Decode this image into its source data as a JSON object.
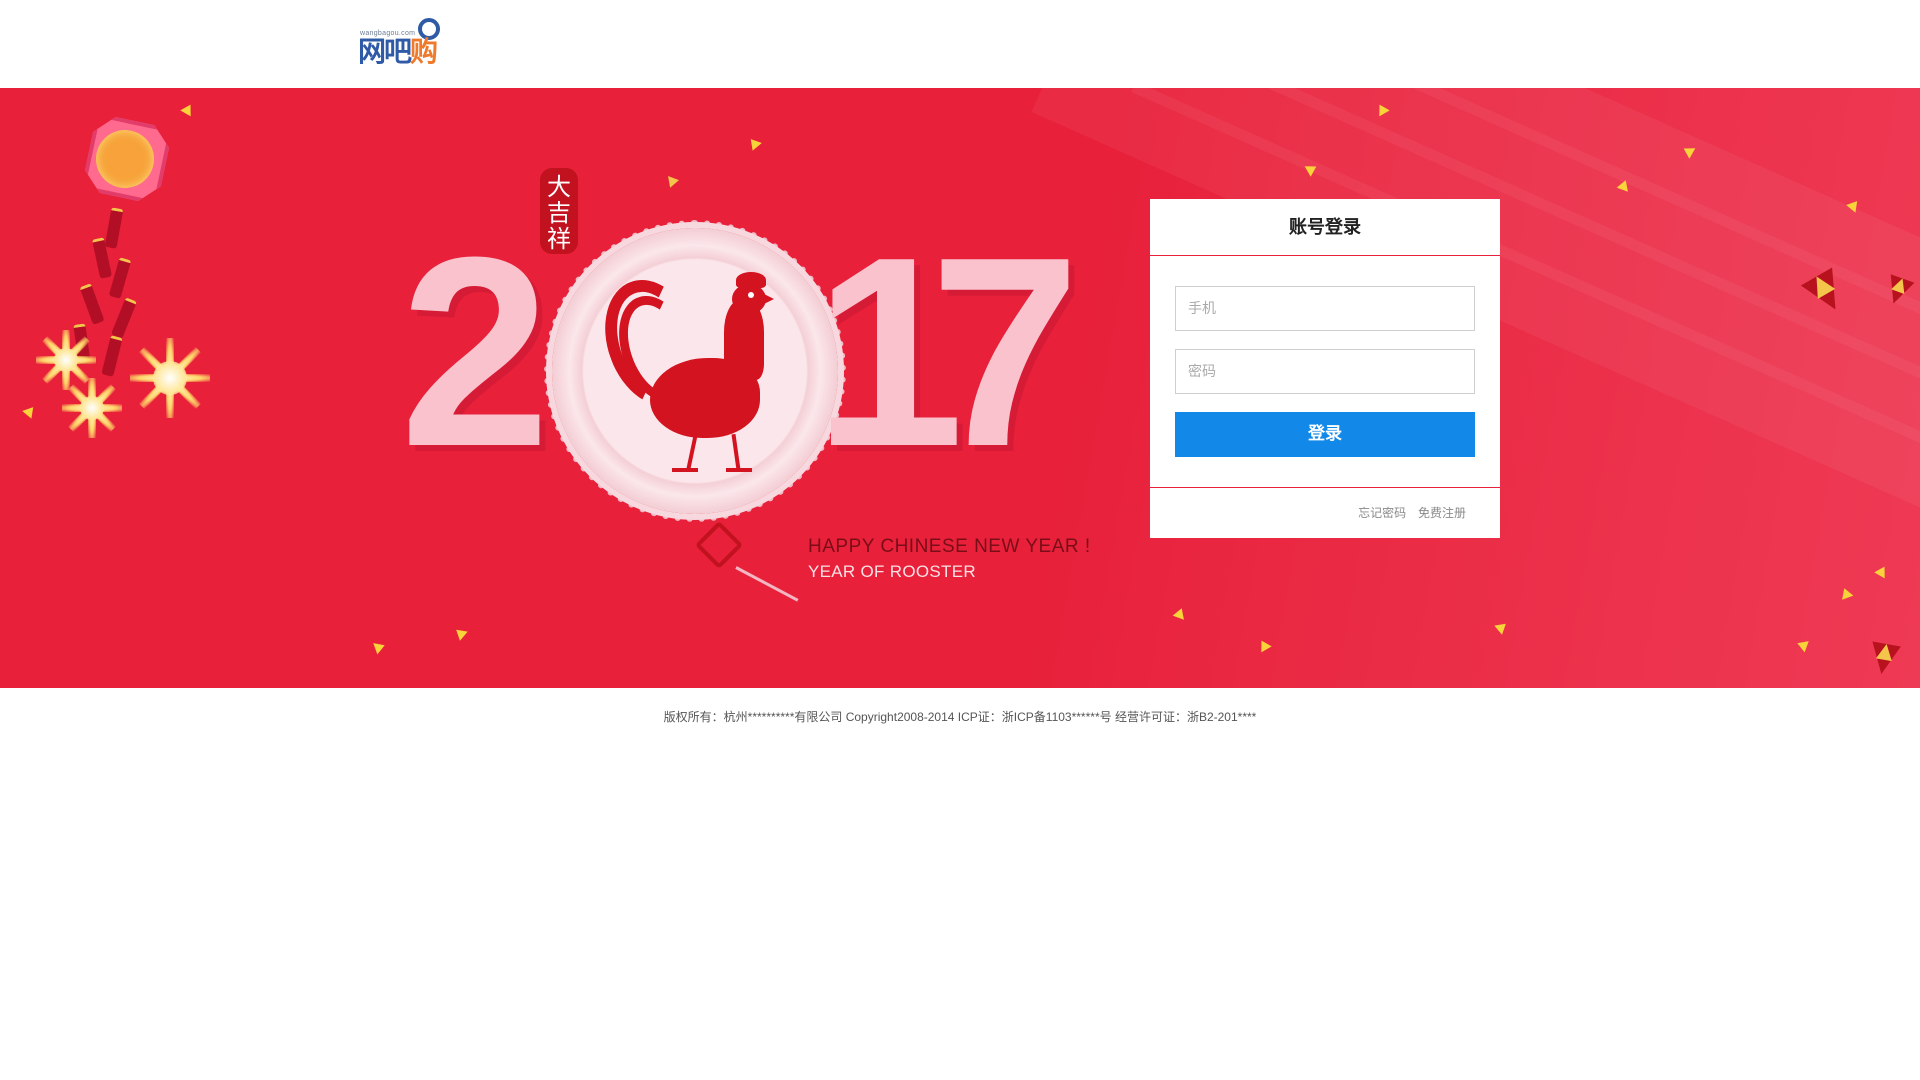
{
  "header": {
    "logo_small_text": "wangbagou.com",
    "logo_text_blue": "网吧",
    "logo_text_orange": "购"
  },
  "banner": {
    "seal_text": "大吉祥",
    "year_digits": [
      "2",
      "1",
      "7"
    ],
    "greeting_line1": "HAPPY CHINESE NEW YEAR !",
    "greeting_line2": "YEAR OF ROOSTER"
  },
  "login": {
    "title": "账号登录",
    "phone_placeholder": "手机",
    "password_placeholder": "密码",
    "submit_label": "登录",
    "forgot_label": "忘记密码",
    "register_label": "免费注册"
  },
  "footer": {
    "copyright": "版权所有：杭州**********有限公司 Copyright2008-2014 ICP证：浙ICP备1103******号 经营许可证：浙B2-201****"
  },
  "colors": {
    "banner_red": "#e8203a",
    "button_blue": "#1288e8",
    "logo_blue": "#2e5aa6",
    "logo_orange": "#ee7a2c"
  },
  "icons": [
    "firecracker-decoration",
    "rooster-papercut",
    "chinese-knot",
    "gold-ingot-decoration"
  ]
}
